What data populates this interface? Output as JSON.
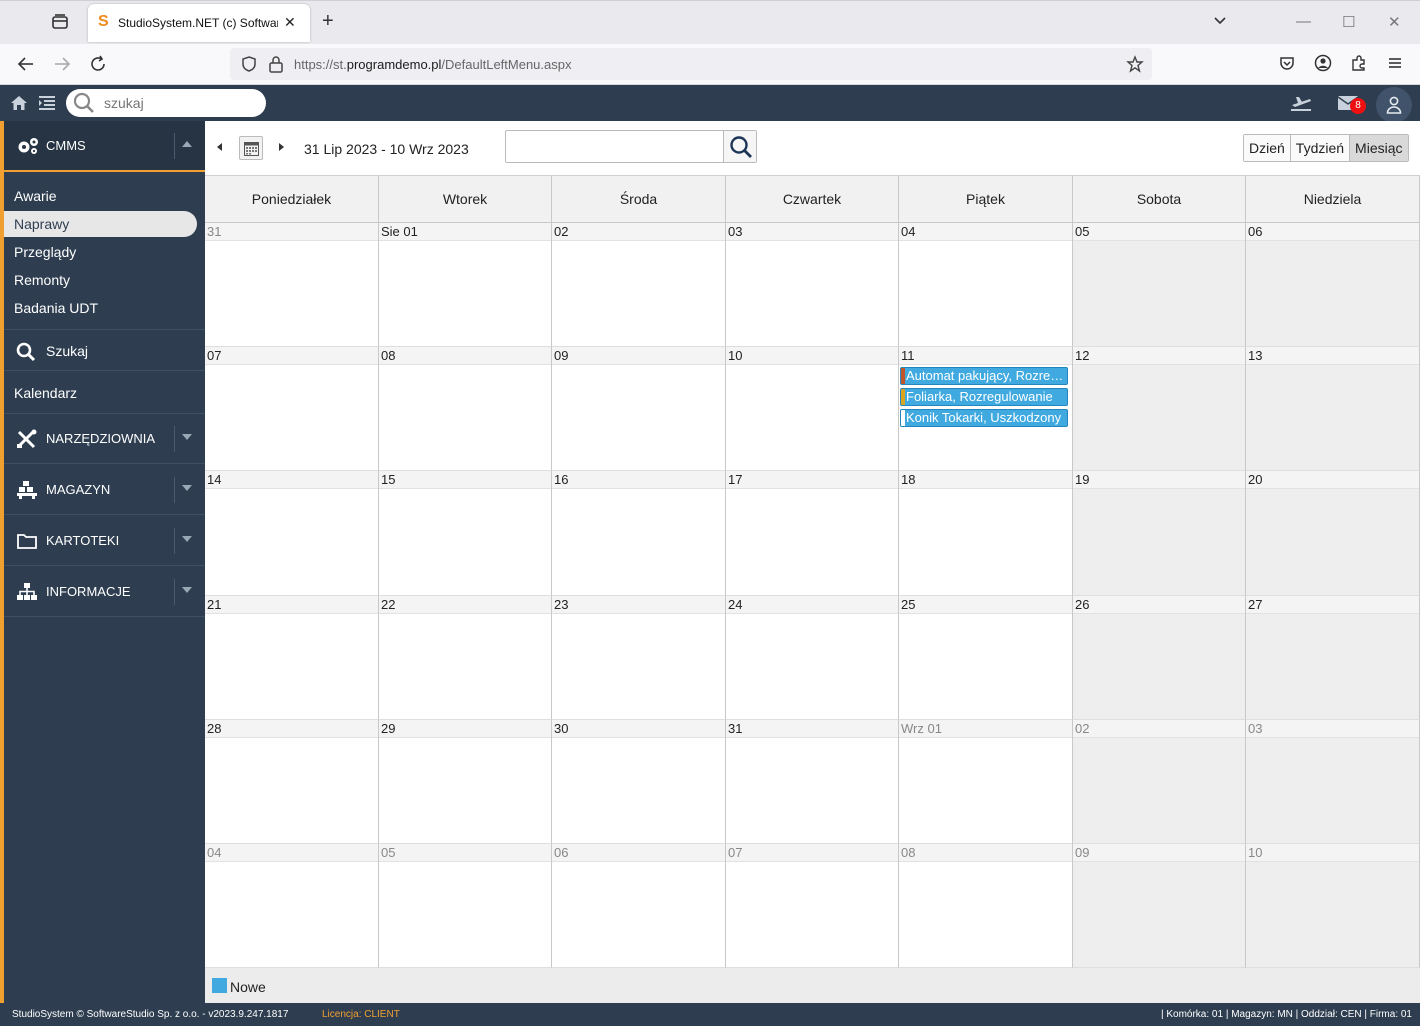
{
  "browser": {
    "tab_title": "StudioSystem.NET (c) SoftwareStudio",
    "url_prefix": "https://st.",
    "url_host": "programdemo.pl",
    "url_path": "/DefaultLeftMenu.aspx"
  },
  "apptop": {
    "search_placeholder": "szukaj",
    "mail_count": "8"
  },
  "sidebar": {
    "cmms_label": "CMMS",
    "sub_items": [
      {
        "label": "Awarie"
      },
      {
        "label": "Naprawy",
        "active": true
      },
      {
        "label": "Przeglądy"
      },
      {
        "label": "Remonty"
      },
      {
        "label": "Badania UDT"
      }
    ],
    "search_label": "Szukaj",
    "calendar_label": "Kalendarz",
    "sections": [
      {
        "label": "NARZĘDZIOWNIA",
        "icon": "tools-icon"
      },
      {
        "label": "MAGAZYN",
        "icon": "warehouse-icon"
      },
      {
        "label": "KARTOTEKI",
        "icon": "folder-icon"
      },
      {
        "label": "INFORMACJE",
        "icon": "sitemap-icon"
      }
    ]
  },
  "calendar": {
    "date_range": "31 Lip 2023 - 10 Wrz 2023",
    "search_value": "",
    "views": [
      "Dzień",
      "Tydzień",
      "Miesiąc"
    ],
    "active_view": "Miesiąc",
    "weekdays": [
      "Poniedziałek",
      "Wtorek",
      "Środa",
      "Czwartek",
      "Piątek",
      "Sobota",
      "Niedziela"
    ],
    "weeks": [
      [
        {
          "d": "31",
          "o": true
        },
        {
          "d": "Sie 01"
        },
        {
          "d": "02"
        },
        {
          "d": "03"
        },
        {
          "d": "04"
        },
        {
          "d": "05"
        },
        {
          "d": "06"
        }
      ],
      [
        {
          "d": "07"
        },
        {
          "d": "08"
        },
        {
          "d": "09"
        },
        {
          "d": "10"
        },
        {
          "d": "11"
        },
        {
          "d": "12"
        },
        {
          "d": "13"
        }
      ],
      [
        {
          "d": "14"
        },
        {
          "d": "15"
        },
        {
          "d": "16"
        },
        {
          "d": "17"
        },
        {
          "d": "18"
        },
        {
          "d": "19"
        },
        {
          "d": "20"
        }
      ],
      [
        {
          "d": "21"
        },
        {
          "d": "22"
        },
        {
          "d": "23"
        },
        {
          "d": "24"
        },
        {
          "d": "25"
        },
        {
          "d": "26"
        },
        {
          "d": "27"
        }
      ],
      [
        {
          "d": "28"
        },
        {
          "d": "29"
        },
        {
          "d": "30"
        },
        {
          "d": "31"
        },
        {
          "d": "Wrz 01",
          "o": true
        },
        {
          "d": "02",
          "o": true
        },
        {
          "d": "03",
          "o": true
        }
      ],
      [
        {
          "d": "04",
          "o": true
        },
        {
          "d": "05",
          "o": true
        },
        {
          "d": "06",
          "o": true
        },
        {
          "d": "07",
          "o": true
        },
        {
          "d": "08",
          "o": true
        },
        {
          "d": "09",
          "o": true
        },
        {
          "d": "10",
          "o": true
        }
      ]
    ],
    "events": [
      {
        "week": 1,
        "day": 4,
        "title": "Automat pakujący, Rozregulowanie",
        "color": "#3fa9e0",
        "stripe": "#c0552a"
      },
      {
        "week": 1,
        "day": 4,
        "title": "Foliarka, Rozregulowanie",
        "color": "#3fa9e0",
        "stripe": "#d9a520"
      },
      {
        "week": 1,
        "day": 4,
        "title": "Konik Tokarki, Uszkodzony",
        "color": "#3fa9e0",
        "stripe": "#ffffff"
      }
    ],
    "legend": [
      {
        "label": "Nowe",
        "color": "#3fa9e0"
      }
    ]
  },
  "statusbar": {
    "left": "StudioSystem © SoftwareStudio Sp. z o.o. - v2023.9.247.1817",
    "license": "Licencja: CLIENT",
    "right": "| Komórka: 01 | Magazyn: MN | Oddział: CEN | Firma: 01"
  },
  "colors": {
    "app_dark": "#2e3e50",
    "accent": "#f0a030",
    "event_blue": "#3fa9e0"
  }
}
